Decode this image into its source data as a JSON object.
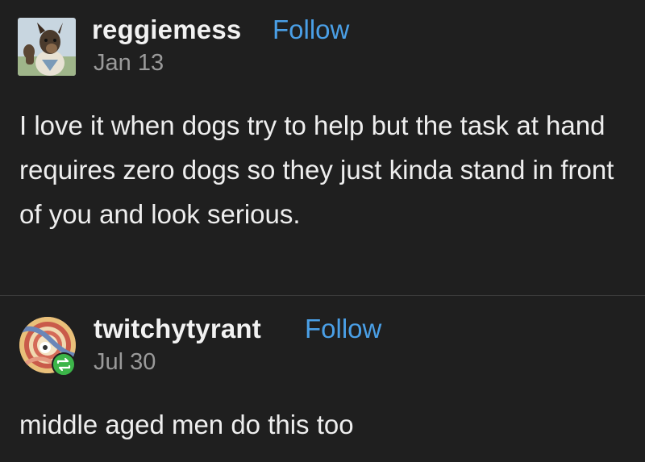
{
  "posts": [
    {
      "username": "reggiemess",
      "follow_label": "Follow",
      "date": "Jan 13",
      "avatar_icon": "dog-avatar-icon",
      "text": "I love it when dogs try to help but the task at hand requires zero dogs so they just kinda stand in front of you and look serious."
    },
    {
      "username": "twitchytyrant",
      "follow_label": "Follow",
      "date": "Jul 30",
      "avatar_icon": "striped-circle-avatar-icon",
      "reblog_icon": "reblog-icon",
      "text": "middle aged men do this too"
    }
  ],
  "colors": {
    "background": "#1f1f1f",
    "text": "#eeeeee",
    "follow": "#4a9fe6",
    "date": "#9a9a9a",
    "reblog_badge": "#3cb549"
  }
}
